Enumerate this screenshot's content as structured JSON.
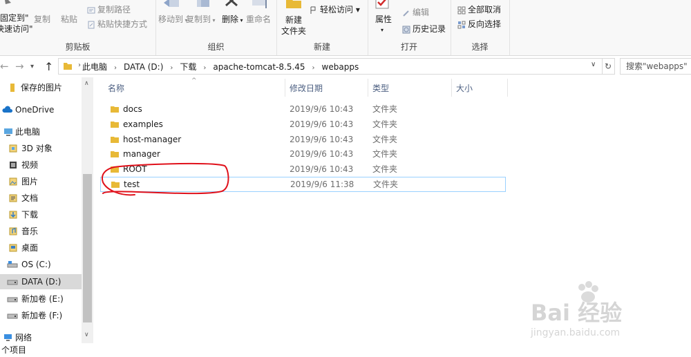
{
  "ribbon": {
    "clipboard": {
      "pin_line1": "固定到\"",
      "pin_line2": "快速访问\"",
      "copy": "复制",
      "paste": "粘贴",
      "copy_path": "复制路径",
      "paste_shortcut": "粘贴快捷方式",
      "group_label": "剪贴板"
    },
    "organize": {
      "move_to": "移动到",
      "copy_to": "复制到",
      "delete": "删除",
      "rename": "重命名",
      "group_label": "组织"
    },
    "new": {
      "new_folder_line1": "新建",
      "new_folder_line2": "文件夹",
      "easy_access": "轻松访问 ▾",
      "group_label": "新建"
    },
    "open": {
      "properties": "属性",
      "edit": "编辑",
      "history": "历史记录",
      "group_label": "打开"
    },
    "select": {
      "select_none": "全部取消",
      "invert": "反向选择",
      "group_label": "选择"
    }
  },
  "address": {
    "crumbs": [
      "此电脑",
      "DATA (D:)",
      "下载",
      "apache-tomcat-8.5.45",
      "webapps"
    ],
    "search_placeholder": "搜索\"webapps\""
  },
  "sidebar": {
    "items": [
      {
        "label": "保存的图片",
        "icon": "folder-icon"
      },
      {
        "label": "OneDrive",
        "icon": "cloud-icon"
      },
      {
        "label": "此电脑",
        "icon": "computer-icon"
      },
      {
        "label": "3D 对象",
        "icon": "cube-icon"
      },
      {
        "label": "视频",
        "icon": "video-icon"
      },
      {
        "label": "图片",
        "icon": "pictures-icon"
      },
      {
        "label": "文档",
        "icon": "documents-icon"
      },
      {
        "label": "下载",
        "icon": "download-icon"
      },
      {
        "label": "音乐",
        "icon": "music-icon"
      },
      {
        "label": "桌面",
        "icon": "desktop-icon"
      },
      {
        "label": "OS (C:)",
        "icon": "os-drive-icon"
      },
      {
        "label": "DATA (D:)",
        "icon": "drive-icon"
      },
      {
        "label": "新加卷 (E:)",
        "icon": "drive-icon"
      },
      {
        "label": "新加卷 (F:)",
        "icon": "drive-icon"
      },
      {
        "label": "网络",
        "icon": "network-icon"
      }
    ]
  },
  "columns": {
    "name": "名称",
    "date": "修改日期",
    "type": "类型",
    "size": "大小"
  },
  "files": [
    {
      "name": "docs",
      "date": "2019/9/6 10:43",
      "type": "文件夹"
    },
    {
      "name": "examples",
      "date": "2019/9/6 10:43",
      "type": "文件夹"
    },
    {
      "name": "host-manager",
      "date": "2019/9/6 10:43",
      "type": "文件夹"
    },
    {
      "name": "manager",
      "date": "2019/9/6 10:43",
      "type": "文件夹"
    },
    {
      "name": "ROOT",
      "date": "2019/9/6 10:43",
      "type": "文件夹"
    },
    {
      "name": "test",
      "date": "2019/9/6 11:38",
      "type": "文件夹"
    }
  ],
  "status": {
    "text": "个项目"
  },
  "watermark": {
    "line1": "Bai 经验",
    "line2": "jingyan.baidu.com"
  },
  "colors": {
    "folder": "#e8b937",
    "column_header": "#4d6082",
    "selection_border": "#99d1ff",
    "annotation": "#e0101a",
    "onedrive": "#1a73c8"
  }
}
